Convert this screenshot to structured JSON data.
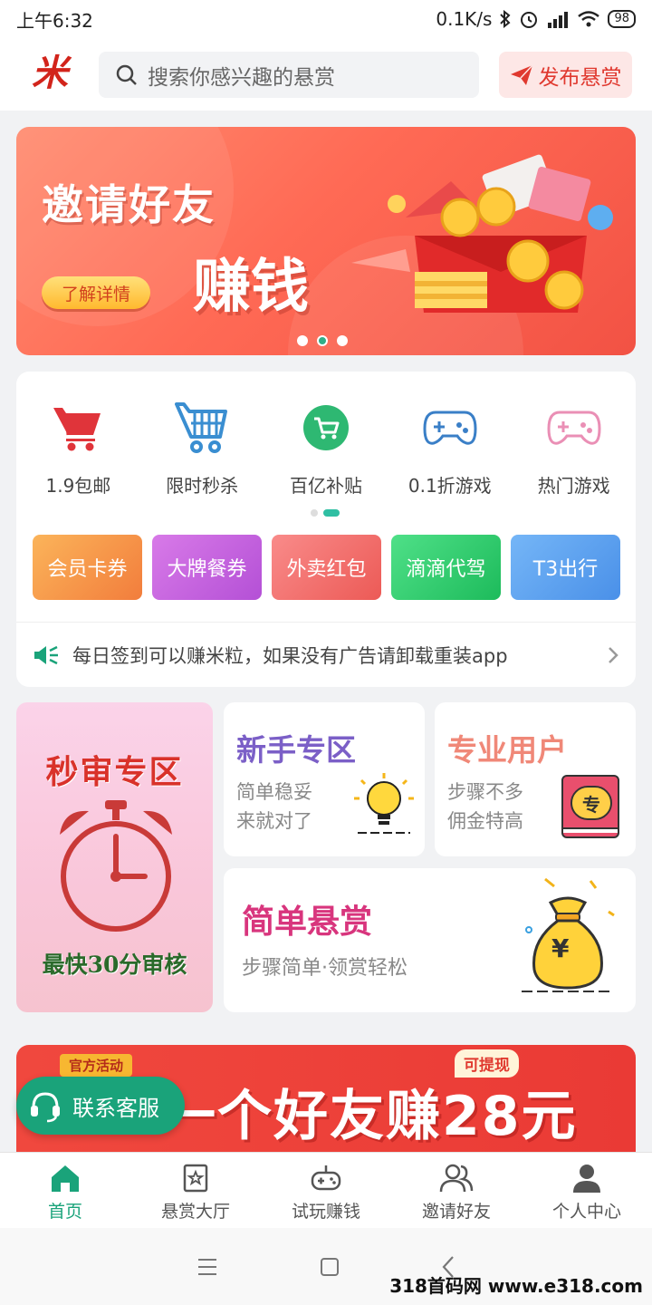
{
  "status": {
    "time": "上午6:32",
    "speed": "0.1K/s",
    "battery": "98"
  },
  "header": {
    "logo": "米",
    "search_placeholder": "搜索你感兴趣的悬赏",
    "publish_label": "发布悬赏"
  },
  "banner": {
    "title": "邀请好友",
    "subtitle": "赚钱",
    "detail_button": "了解详情",
    "active_dot": 1
  },
  "categories": [
    {
      "label": "1.9包邮",
      "icon": "cart-icon",
      "color": "#e0343a"
    },
    {
      "label": "限时秒杀",
      "icon": "shopping-basket-icon",
      "color": "#3a8ed1"
    },
    {
      "label": "百亿补贴",
      "icon": "green-cart-icon",
      "color": "#2eb872"
    },
    {
      "label": "0.1折游戏",
      "icon": "gamepad-icon",
      "color": "#3a7fc7"
    },
    {
      "label": "热门游戏",
      "icon": "gamepad-pink-icon",
      "color": "#ea8fb5"
    }
  ],
  "coupons": [
    {
      "label": "会员卡券",
      "color_from": "#fbb45a",
      "color_to": "#f27d3c"
    },
    {
      "label": "大牌餐券",
      "color_from": "#d87ae8",
      "color_to": "#b450d6"
    },
    {
      "label": "外卖红包",
      "color_from": "#f98b8a",
      "color_to": "#ec5a56"
    },
    {
      "label": "滴滴代驾",
      "color_from": "#4fe088",
      "color_to": "#1dbb5b"
    },
    {
      "label": "T3出行",
      "color_from": "#75b6f7",
      "color_to": "#4a90e8"
    }
  ],
  "notice": {
    "text": "每日签到可以赚米粒，如果没有广告请卸载重装app"
  },
  "features": {
    "quick_review": {
      "title": "秒审专区",
      "subtitle": "最快30分审核"
    },
    "newbie": {
      "title": "新手专区",
      "line1": "简单稳妥",
      "line2": "来就对了",
      "color": "#7b5fc7"
    },
    "pro": {
      "title": "专业用户",
      "line1": "步骤不多",
      "line2": "佣金特高",
      "color": "#f08878",
      "badge": "专"
    },
    "simple": {
      "title": "简单悬赏",
      "desc": "步骤简单·领赏轻松",
      "color": "#d8357d",
      "bag_symbol": "¥"
    }
  },
  "promo": {
    "tag": "官方活动",
    "withdraw_tag": "可提现",
    "text": "一个好友赚28元"
  },
  "service": {
    "label": "联系客服"
  },
  "tabs": [
    {
      "label": "首页",
      "icon": "home-icon",
      "active": true
    },
    {
      "label": "悬赏大厅",
      "icon": "star-bookmark-icon",
      "active": false
    },
    {
      "label": "试玩赚钱",
      "icon": "gamepad-outline-icon",
      "active": false
    },
    {
      "label": "邀请好友",
      "icon": "users-icon",
      "active": false
    },
    {
      "label": "个人中心",
      "icon": "person-icon",
      "active": false
    }
  ],
  "watermark": "318首码网 www.e318.com"
}
